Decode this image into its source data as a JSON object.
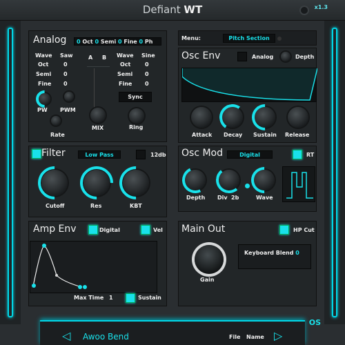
{
  "title_plain": "Defiant",
  "title_bold": "WT",
  "version": "x1.3",
  "analog": {
    "title": "Analog",
    "header_oct_value": "0",
    "header_oct_label": "Oct",
    "header_semi_value": "0",
    "header_semi_label": "Semi",
    "header_fine_value": "0",
    "header_fine_label": "Fine",
    "header_ph_value": "0",
    "header_ph_label": "Ph",
    "left": {
      "wave_label": "Wave",
      "wave_value": "Saw",
      "oct_label": "Oct",
      "oct_value": "0",
      "semi_label": "Semi",
      "semi_value": "0",
      "fine_label": "Fine",
      "fine_value": "0"
    },
    "ab_a": "A",
    "ab_b": "B",
    "right": {
      "wave_label": "Wave",
      "wave_value": "Sine",
      "oct_label": "Oct",
      "oct_value": "0",
      "semi_label": "Semi",
      "semi_value": "0",
      "fine_label": "Fine",
      "fine_value": "0"
    },
    "sync": "Sync",
    "knobs": {
      "pw": "PW",
      "pwm": "PWM",
      "rate": "Rate",
      "mix": "MIX",
      "ring": "Ring"
    }
  },
  "filter": {
    "title": "Filter",
    "type": "Low Pass",
    "db": "12db",
    "cutoff": "Cutoff",
    "res": "Res",
    "kbt": "KBT"
  },
  "amp_env": {
    "title": "Amp Env",
    "digital": "Digital",
    "vel": "Vel",
    "max_time_label": "Max Time",
    "max_time_value": "1",
    "sustain": "Sustain"
  },
  "menu": {
    "label": "Menu:",
    "value": "Pitch Section"
  },
  "osc_env": {
    "title": "Osc Env",
    "analog": "Analog",
    "depth": "Depth",
    "attack": "Attack",
    "decay": "Decay",
    "sustain": "Sustain",
    "release": "Release"
  },
  "osc_mod": {
    "title": "Osc Mod",
    "mode": "Digital",
    "rt": "RT",
    "depth": "Depth",
    "div": "Div",
    "div_value": "2b",
    "wave": "Wave"
  },
  "main_out": {
    "title": "Main Out",
    "hp_cut": "HP Cut",
    "gain": "Gain",
    "keyboard_blend_label": "Keyboard Blend",
    "keyboard_blend_value": "0"
  },
  "footer": {
    "preset": "Awoo Bend",
    "file": "File",
    "name": "Name",
    "os": "OS"
  },
  "colors": {
    "accent": "#19e1ea",
    "background": "#2a2e31",
    "panel": "#222628"
  }
}
